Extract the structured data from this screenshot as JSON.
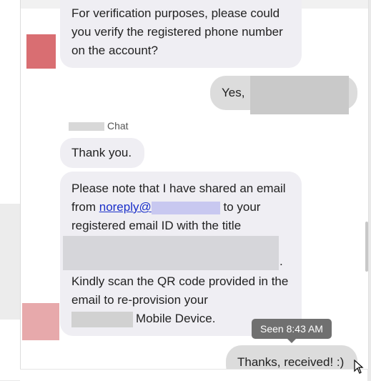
{
  "messages": {
    "verify_text": "For verification purposes, please could you verify the registered phone number on the account?",
    "reply_yes": "Yes,",
    "sender_suffix": "Chat",
    "thank_you": "Thank you.",
    "note_part1": "Please note that I have shared an email from",
    "note_link": "noreply@",
    "note_part2": "to your registered email ID with the title",
    "note_period": ".",
    "note_part3": "Kindly scan the QR code provided in the email to re-provision your",
    "note_part4": "Mobile Device.",
    "user_final": "Thanks, received! :)",
    "seen_tooltip": "Seen 8:43 AM"
  },
  "colors": {
    "incoming_bubble": "#efeef3",
    "outgoing_bubble": "#dcdcdc",
    "link": "#1a2fc9",
    "tooltip": "#707070"
  },
  "icons": {
    "cursor": "mouse-pointer-icon"
  }
}
